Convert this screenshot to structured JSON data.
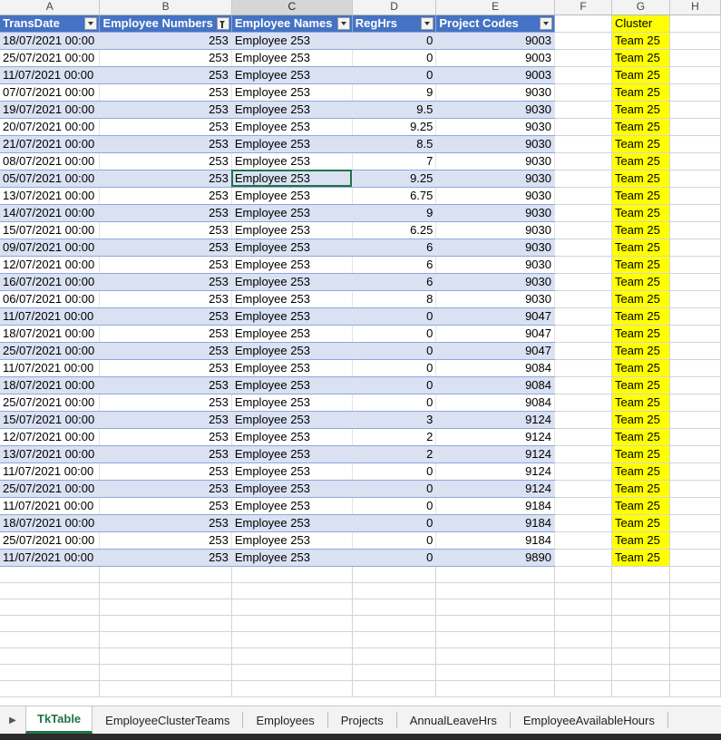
{
  "columns": [
    "A",
    "B",
    "C",
    "D",
    "E",
    "F",
    "G",
    "H"
  ],
  "selected_column": "C",
  "headers": {
    "transdate": "TransDate",
    "employee_numbers": "Employee Numbers",
    "employee_names": "Employee Names",
    "reghrs": "RegHrs",
    "project_codes": "Project Codes",
    "cluster": "Cluster"
  },
  "cluster_value": "Team 25",
  "rows": [
    {
      "date": "18/07/2021 00:00",
      "num": "253",
      "name": "Employee 253",
      "hrs": "0",
      "code": "9003"
    },
    {
      "date": "25/07/2021 00:00",
      "num": "253",
      "name": "Employee 253",
      "hrs": "0",
      "code": "9003"
    },
    {
      "date": "11/07/2021 00:00",
      "num": "253",
      "name": "Employee 253",
      "hrs": "0",
      "code": "9003"
    },
    {
      "date": "07/07/2021 00:00",
      "num": "253",
      "name": "Employee 253",
      "hrs": "9",
      "code": "9030"
    },
    {
      "date": "19/07/2021 00:00",
      "num": "253",
      "name": "Employee 253",
      "hrs": "9.5",
      "code": "9030"
    },
    {
      "date": "20/07/2021 00:00",
      "num": "253",
      "name": "Employee 253",
      "hrs": "9.25",
      "code": "9030"
    },
    {
      "date": "21/07/2021 00:00",
      "num": "253",
      "name": "Employee 253",
      "hrs": "8.5",
      "code": "9030"
    },
    {
      "date": "08/07/2021 00:00",
      "num": "253",
      "name": "Employee 253",
      "hrs": "7",
      "code": "9030"
    },
    {
      "date": "05/07/2021 00:00",
      "num": "253",
      "name": "Employee 253",
      "hrs": "9.25",
      "code": "9030"
    },
    {
      "date": "13/07/2021 00:00",
      "num": "253",
      "name": "Employee 253",
      "hrs": "6.75",
      "code": "9030"
    },
    {
      "date": "14/07/2021 00:00",
      "num": "253",
      "name": "Employee 253",
      "hrs": "9",
      "code": "9030"
    },
    {
      "date": "15/07/2021 00:00",
      "num": "253",
      "name": "Employee 253",
      "hrs": "6.25",
      "code": "9030"
    },
    {
      "date": "09/07/2021 00:00",
      "num": "253",
      "name": "Employee 253",
      "hrs": "6",
      "code": "9030"
    },
    {
      "date": "12/07/2021 00:00",
      "num": "253",
      "name": "Employee 253",
      "hrs": "6",
      "code": "9030"
    },
    {
      "date": "16/07/2021 00:00",
      "num": "253",
      "name": "Employee 253",
      "hrs": "6",
      "code": "9030"
    },
    {
      "date": "06/07/2021 00:00",
      "num": "253",
      "name": "Employee 253",
      "hrs": "8",
      "code": "9030"
    },
    {
      "date": "11/07/2021 00:00",
      "num": "253",
      "name": "Employee 253",
      "hrs": "0",
      "code": "9047"
    },
    {
      "date": "18/07/2021 00:00",
      "num": "253",
      "name": "Employee 253",
      "hrs": "0",
      "code": "9047"
    },
    {
      "date": "25/07/2021 00:00",
      "num": "253",
      "name": "Employee 253",
      "hrs": "0",
      "code": "9047"
    },
    {
      "date": "11/07/2021 00:00",
      "num": "253",
      "name": "Employee 253",
      "hrs": "0",
      "code": "9084"
    },
    {
      "date": "18/07/2021 00:00",
      "num": "253",
      "name": "Employee 253",
      "hrs": "0",
      "code": "9084"
    },
    {
      "date": "25/07/2021 00:00",
      "num": "253",
      "name": "Employee 253",
      "hrs": "0",
      "code": "9084"
    },
    {
      "date": "15/07/2021 00:00",
      "num": "253",
      "name": "Employee 253",
      "hrs": "3",
      "code": "9124"
    },
    {
      "date": "12/07/2021 00:00",
      "num": "253",
      "name": "Employee 253",
      "hrs": "2",
      "code": "9124"
    },
    {
      "date": "13/07/2021 00:00",
      "num": "253",
      "name": "Employee 253",
      "hrs": "2",
      "code": "9124"
    },
    {
      "date": "11/07/2021 00:00",
      "num": "253",
      "name": "Employee 253",
      "hrs": "0",
      "code": "9124"
    },
    {
      "date": "25/07/2021 00:00",
      "num": "253",
      "name": "Employee 253",
      "hrs": "0",
      "code": "9124"
    },
    {
      "date": "11/07/2021 00:00",
      "num": "253",
      "name": "Employee 253",
      "hrs": "0",
      "code": "9184"
    },
    {
      "date": "18/07/2021 00:00",
      "num": "253",
      "name": "Employee 253",
      "hrs": "0",
      "code": "9184"
    },
    {
      "date": "25/07/2021 00:00",
      "num": "253",
      "name": "Employee 253",
      "hrs": "0",
      "code": "9184"
    },
    {
      "date": "11/07/2021 00:00",
      "num": "253",
      "name": "Employee 253",
      "hrs": "0",
      "code": "9890"
    }
  ],
  "active_cell": "C10",
  "tabs": [
    "TkTable",
    "EmployeeClusterTeams",
    "Employees",
    "Projects",
    "AnnualLeaveHrs",
    "EmployeeAvailableHours"
  ],
  "active_tab": "TkTable",
  "colors": {
    "table_header": "#4472c4",
    "band": "#d9e1f2",
    "highlight": "#ffff00",
    "excel_green": "#217346"
  }
}
